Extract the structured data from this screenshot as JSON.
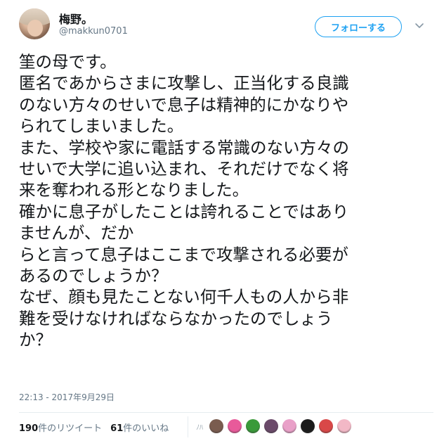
{
  "header": {
    "display_name": "梅野。",
    "screen_name": "@makkun0701",
    "follow_label": "フォローする"
  },
  "tweet": {
    "lines": [
      "筀の母です。",
      "匿名であからさまに攻撃し、正当化する良識",
      "のない方々のせいで息子は精神的にかなりや",
      "られてしまいました。",
      "また、学校や家に電話する常識のない方々の",
      "せいで大学に追い込まれ、それだけでなく将",
      "来を奪われる形となりました。",
      "確かに息子がしたことは誇れることではあり",
      "ませんが、だか",
      "らと言って息子はここまで攻撃される必要が",
      "あるのでしょうか？",
      "なぜ、顔も見たことない何千人もの人から非",
      "難を受けなければならなかったのでしょう",
      "か？"
    ],
    "timestamp": "22:13 - 2017年9月29日"
  },
  "stats": {
    "retweets_count": "190",
    "retweets_label": "件のリツイート",
    "likes_count": "61",
    "likes_label": "件のいいね"
  },
  "colors": {
    "accent": "#1da1f2",
    "secondary_text": "#657786",
    "divider": "#e6ecf0",
    "liker_avatars": [
      "#dfe3e6",
      "#7a5c4f",
      "#e85a9a",
      "#3a9a3a",
      "#6b4a6a",
      "#e9a0c8",
      "#1b1b1b",
      "#d94848",
      "#f2b8c6"
    ]
  },
  "icons": {
    "menu": "chevron-down-icon",
    "liker_placeholder": "dash-icon"
  }
}
